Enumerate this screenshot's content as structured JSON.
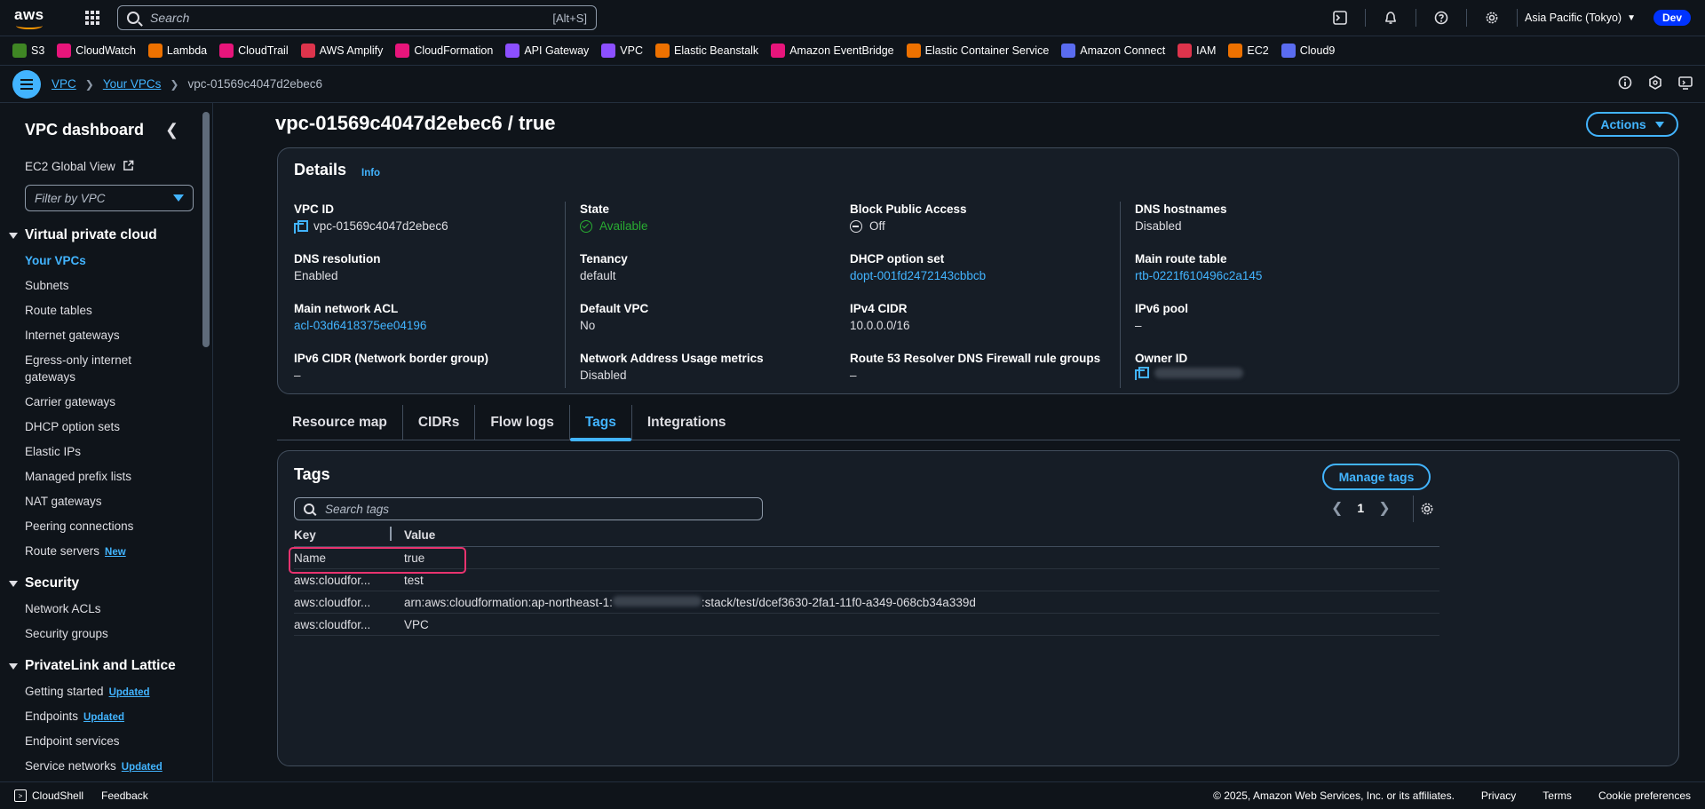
{
  "topnav": {
    "logo": "aws",
    "search_placeholder": "Search",
    "search_shortcut": "[Alt+S]",
    "region": "Asia Pacific (Tokyo)",
    "account": "Dev"
  },
  "favorites": [
    {
      "label": "S3",
      "color": "#3f8624"
    },
    {
      "label": "CloudWatch",
      "color": "#e7157b"
    },
    {
      "label": "Lambda",
      "color": "#ed7100"
    },
    {
      "label": "CloudTrail",
      "color": "#e7157b"
    },
    {
      "label": "AWS Amplify",
      "color": "#dd344c"
    },
    {
      "label": "CloudFormation",
      "color": "#e7157b"
    },
    {
      "label": "API Gateway",
      "color": "#8c4fff"
    },
    {
      "label": "VPC",
      "color": "#8c4fff"
    },
    {
      "label": "Elastic Beanstalk",
      "color": "#ed7100"
    },
    {
      "label": "Amazon EventBridge",
      "color": "#e7157b"
    },
    {
      "label": "Elastic Container Service",
      "color": "#ed7100"
    },
    {
      "label": "Amazon Connect",
      "color": "#5a6cf0"
    },
    {
      "label": "IAM",
      "color": "#dd344c"
    },
    {
      "label": "EC2",
      "color": "#ed7100"
    },
    {
      "label": "Cloud9",
      "color": "#5a6cf0"
    }
  ],
  "breadcrumb": {
    "items": [
      "VPC",
      "Your VPCs"
    ],
    "current": "vpc-01569c4047d2ebec6"
  },
  "sidebar": {
    "title": "VPC dashboard",
    "global_view": "EC2 Global View",
    "filter_placeholder": "Filter by VPC",
    "sections": {
      "vpc": "Virtual private cloud",
      "security": "Security",
      "privatelink": "PrivateLink and Lattice"
    },
    "vpc_items": [
      "Your VPCs",
      "Subnets",
      "Route tables",
      "Internet gateways",
      "Egress-only internet gateways",
      "Carrier gateways",
      "DHCP option sets",
      "Elastic IPs",
      "Managed prefix lists",
      "NAT gateways",
      "Peering connections",
      "Route servers"
    ],
    "route_servers_badge": "New",
    "security_items": [
      "Network ACLs",
      "Security groups"
    ],
    "privatelink_items": [
      "Getting started",
      "Endpoints",
      "Endpoint services",
      "Service networks"
    ],
    "updated_badge": "Updated"
  },
  "page": {
    "title": "vpc-01569c4047d2ebec6 / true",
    "actions_label": "Actions"
  },
  "details": {
    "title": "Details",
    "info": "Info",
    "fields": {
      "vpc_id": {
        "label": "VPC ID",
        "value": "vpc-01569c4047d2ebec6"
      },
      "dns_resolution": {
        "label": "DNS resolution",
        "value": "Enabled"
      },
      "main_acl": {
        "label": "Main network ACL",
        "value": "acl-03d6418375ee04196"
      },
      "ipv6_cidr": {
        "label": "IPv6 CIDR (Network border group)",
        "value": "–"
      },
      "state": {
        "label": "State",
        "value": "Available"
      },
      "tenancy": {
        "label": "Tenancy",
        "value": "default"
      },
      "default_vpc": {
        "label": "Default VPC",
        "value": "No"
      },
      "nau_metrics": {
        "label": "Network Address Usage metrics",
        "value": "Disabled"
      },
      "bpa": {
        "label": "Block Public Access",
        "value": "Off"
      },
      "dhcp": {
        "label": "DHCP option set",
        "value": "dopt-001fd2472143cbbcb"
      },
      "ipv4_cidr": {
        "label": "IPv4 CIDR",
        "value": "10.0.0.0/16"
      },
      "r53": {
        "label": "Route 53 Resolver DNS Firewall rule groups",
        "value": "–"
      },
      "dns_hostnames": {
        "label": "DNS hostnames",
        "value": "Disabled"
      },
      "main_rt": {
        "label": "Main route table",
        "value": "rtb-0221f610496c2a145"
      },
      "ipv6_pool": {
        "label": "IPv6 pool",
        "value": "–"
      },
      "owner_id": {
        "label": "Owner ID",
        "value": ""
      }
    }
  },
  "tabs": [
    "Resource map",
    "CIDRs",
    "Flow logs",
    "Tags",
    "Integrations"
  ],
  "tags": {
    "title": "Tags",
    "manage_label": "Manage tags",
    "search_placeholder": "Search tags",
    "page": "1",
    "columns": {
      "key": "Key",
      "value": "Value"
    },
    "rows": [
      {
        "key": "Name",
        "value": "true"
      },
      {
        "key": "aws:cloudfor...",
        "value": "test"
      },
      {
        "key": "aws:cloudfor...",
        "value_prefix": "arn:aws:cloudformation:ap-northeast-1:",
        "value_suffix": ":stack/test/dcef3630-2fa1-11f0-a349-068cb34a339d"
      },
      {
        "key": "aws:cloudfor...",
        "value": "VPC"
      }
    ]
  },
  "footer": {
    "cloudshell": "CloudShell",
    "feedback": "Feedback",
    "copyright": "© 2025, Amazon Web Services, Inc. or its affiliates.",
    "privacy": "Privacy",
    "terms": "Terms",
    "cookies": "Cookie preferences"
  }
}
